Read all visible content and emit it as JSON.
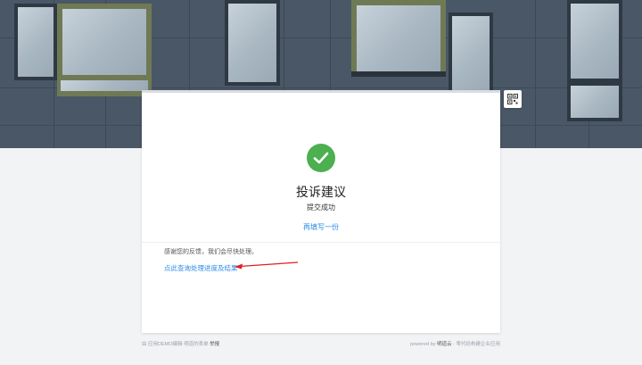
{
  "form": {
    "title": "投诉建议",
    "status": "提交成功",
    "fill_again_label": "再填写一份"
  },
  "message": {
    "thanks": "感谢您的反馈，我们会尽快处理。",
    "progress_link": "点此查询处理进度及结果"
  },
  "footer": {
    "left_prefix": "由",
    "left_app": "应用DEMO编辑 明道的表单",
    "left_action": "举报",
    "right_prefix": "powered by",
    "right_brand": "明道云",
    "right_suffix": "- 零代码构建企业应用"
  },
  "colors": {
    "success": "#4caf50",
    "link": "#2c8ae8",
    "arrow": "#e02020"
  },
  "icons": {
    "success": "check-circle-icon",
    "qr": "qr-code-icon"
  }
}
